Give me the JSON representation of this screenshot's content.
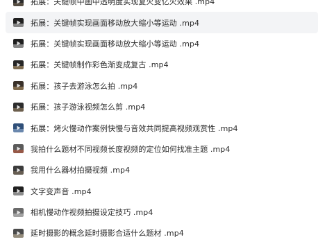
{
  "file_list": {
    "items": [
      {
        "name": "拓展：关键帧中画中透明度实现复火变亿火效果 .mp4",
        "icon": "video-thumbnail-icon",
        "color": "#2a2a2a",
        "accent": "#7a6a55"
      },
      {
        "name": "拓展：关键帧实现画面移动放大缩小等运动 .mp4",
        "icon": "video-thumbnail-icon",
        "color": "#1f1f1f",
        "accent": "#d9d9d9",
        "selected": true
      },
      {
        "name": "拓展：关键帧实现画面移动放大缩小等运动 .mp4",
        "icon": "video-thumbnail-icon",
        "color": "#1f1f1f",
        "accent": "#d9d9d9"
      },
      {
        "name": "拓展：关键帧制作彩色渐变成复古 .mp4",
        "icon": "video-thumbnail-icon",
        "color": "#262626",
        "accent": "#c9a877"
      },
      {
        "name": "拓展：孩子去游泳怎么拍 .mp4",
        "icon": "video-thumbnail-icon",
        "color": "#3a3129",
        "accent": "#b99a6e"
      },
      {
        "name": "拓展：孩子游泳视频怎么剪 .mp4",
        "icon": "video-thumbnail-icon",
        "color": "#2c2c2c",
        "accent": "#a38b6a"
      },
      {
        "name": "拓展：烤火慢动作案例快慢与音效共同提高视频观赏性 .mp4",
        "icon": "video-thumbnail-icon",
        "color": "#2f4f79",
        "accent": "#9ab7d8"
      },
      {
        "name": "我拍什么题材不同视频长度视频的定位如何找准主题 .mp4",
        "icon": "video-thumbnail-icon",
        "color": "#5a5a5a",
        "accent": "#c85a3a"
      },
      {
        "name": "我用什么器材拍摄视频 .mp4",
        "icon": "video-thumbnail-icon",
        "color": "#3b3b3b",
        "accent": "#8b7a66"
      },
      {
        "name": "文字变声音 .mp4",
        "icon": "video-thumbnail-icon",
        "color": "#1f1f1f",
        "accent": "#e6e6e6"
      },
      {
        "name": "相机慢动作视频拍摄设定技巧 .mp4",
        "icon": "video-thumbnail-icon",
        "color": "#6a6a6a",
        "accent": "#cfcfcf"
      },
      {
        "name": "延时摄影的概念延时摄影合适什么题材 .mp4",
        "icon": "video-thumbnail-icon",
        "color": "#4a4a4a",
        "accent": "#d2c2a5"
      }
    ]
  },
  "colors": {
    "selected_row_bg": "#f3f4f6",
    "text": "#2b2b2b"
  }
}
